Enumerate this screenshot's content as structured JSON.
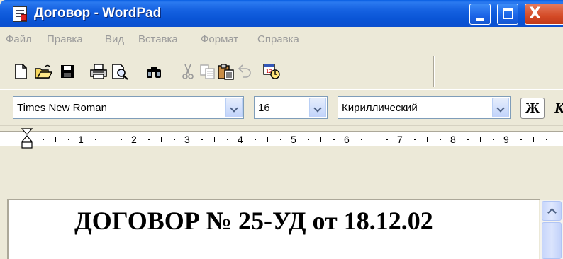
{
  "window": {
    "title": "Договор - WordPad",
    "close_glyph": "X"
  },
  "menu": {
    "items": [
      "Файл",
      "Правка",
      "Вид",
      "Вставка",
      "Формат",
      "Справка"
    ]
  },
  "toolbar": {
    "icons": [
      "new-document-icon",
      "open-folder-icon",
      "save-icon",
      "print-icon",
      "print-preview-icon",
      "find-icon",
      "cut-icon",
      "copy-icon",
      "paste-icon",
      "undo-icon",
      "insert-datetime-icon"
    ]
  },
  "formatbar": {
    "font_name": "Times New Roman",
    "font_size": "16",
    "script": "Кириллический",
    "bold_label": "Ж",
    "italic_label": "К"
  },
  "ruler": {
    "numbers": [
      "1",
      "2",
      "3",
      "4",
      "5",
      "6",
      "7",
      "8",
      "9"
    ]
  },
  "document": {
    "heading": "ДОГОВОР № 25-УД от 18.12.02"
  },
  "colors": {
    "titlebar": "#0a55d6",
    "face": "#ece9d8",
    "close": "#d44a26"
  }
}
